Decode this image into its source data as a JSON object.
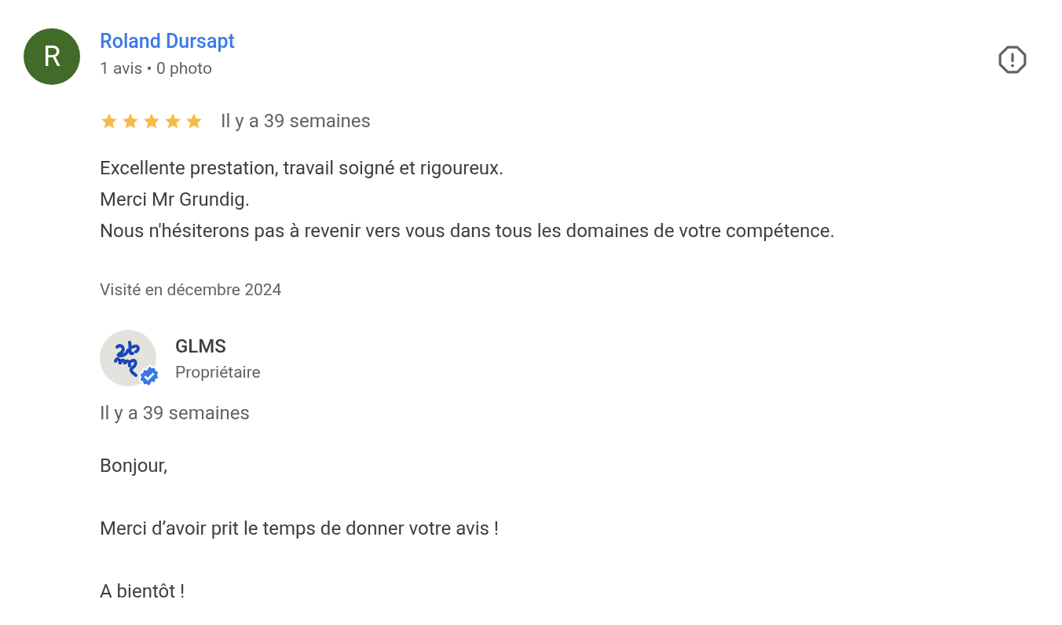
{
  "reviewer": {
    "initial": "R",
    "name": "Roland Dursapt",
    "meta": "1 avis • 0 photo"
  },
  "review": {
    "stars": 5,
    "time": "Il y a 39 semaines",
    "lines": [
      "Excellente prestation, travail soigné et rigoureux.",
      "Merci Mr Grundig.",
      "Nous n'hésiterons pas à revenir vers vous dans tous les domaines de votre compétence."
    ],
    "visited": "Visité en décembre 2024"
  },
  "owner_reply": {
    "name": "GLMS",
    "role": "Propriétaire",
    "verified": true,
    "time": "Il y a 39 semaines",
    "paragraphs": [
      "Bonjour,",
      "Merci d’avoir prit le temps de donner votre avis !",
      "A bientôt !"
    ]
  }
}
